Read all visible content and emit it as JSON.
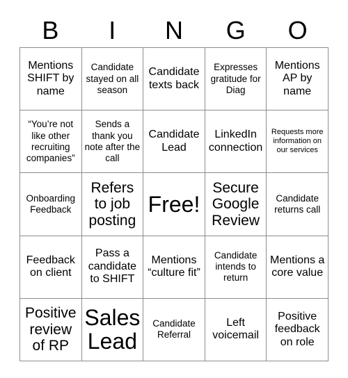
{
  "header": {
    "letters": [
      "B",
      "I",
      "N",
      "G",
      "O"
    ]
  },
  "grid": {
    "rows": 5,
    "columns": 5,
    "border_color": "#8c8c8c",
    "cells": [
      {
        "text": "Mentions SHIFT by name",
        "size": "md"
      },
      {
        "text": "Candidate stayed on all season",
        "size": "sm"
      },
      {
        "text": "Candidate texts back",
        "size": "md"
      },
      {
        "text": "Expresses gratitude for Diag",
        "size": "sm"
      },
      {
        "text": "Mentions AP by name",
        "size": "md"
      },
      {
        "text": "“You’re not like other recruiting companies”",
        "size": "sm"
      },
      {
        "text": "Sends a thank you note after the call",
        "size": "sm"
      },
      {
        "text": "Candidate Lead",
        "size": "md"
      },
      {
        "text": "LinkedIn connection",
        "size": "md"
      },
      {
        "text": "Requests more information on our services",
        "size": "xs"
      },
      {
        "text": "Onboarding Feedback",
        "size": "sm"
      },
      {
        "text": "Refers to job posting",
        "size": "lg"
      },
      {
        "text": "Free!",
        "size": "xl"
      },
      {
        "text": "Secure Google Review",
        "size": "lg"
      },
      {
        "text": "Candidate returns call",
        "size": "sm"
      },
      {
        "text": "Feedback on client",
        "size": "md"
      },
      {
        "text": "Pass a candidate to SHIFT",
        "size": "md"
      },
      {
        "text": "Mentions “culture fit”",
        "size": "md"
      },
      {
        "text": "Candidate intends to return",
        "size": "sm"
      },
      {
        "text": "Mentions a core value",
        "size": "md"
      },
      {
        "text": "Positive review of RP",
        "size": "lg"
      },
      {
        "text": "Sales Lead",
        "size": "xl"
      },
      {
        "text": "Candidate Referral",
        "size": "sm"
      },
      {
        "text": "Left voicemail",
        "size": "md"
      },
      {
        "text": "Positive feedback on role",
        "size": "md"
      }
    ]
  }
}
